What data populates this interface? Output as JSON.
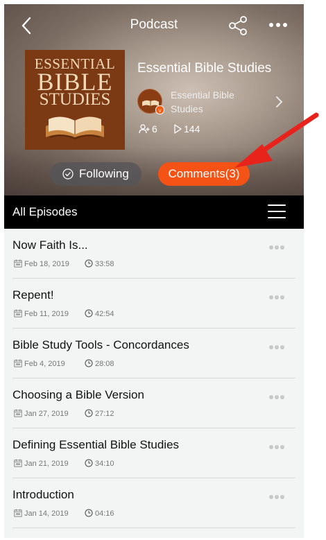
{
  "header": {
    "title": "Podcast",
    "back_icon": "chevron-left-icon",
    "share_icon": "share-icon",
    "more_icon": "ellipsis-icon"
  },
  "podcast": {
    "cover_lines": [
      "ESSENTIAL",
      "BIBLE",
      "STUDIES"
    ],
    "name": "Essential Bible Studies",
    "author": "Essential Bible Studies",
    "author_badge": "v",
    "subscribers": "6",
    "plays": "144"
  },
  "actions": {
    "following_label": "Following",
    "comments_label": "Comments(3)"
  },
  "episodes_bar": {
    "label": "All Episodes"
  },
  "episodes": [
    {
      "title": "Now Faith Is...",
      "date": "Feb 18, 2019",
      "duration": "33:58"
    },
    {
      "title": "Repent!",
      "date": "Feb 11, 2019",
      "duration": "42:54"
    },
    {
      "title": "Bible Study Tools - Concordances",
      "date": "Feb 4, 2019",
      "duration": "28:08"
    },
    {
      "title": "Choosing a Bible Version",
      "date": "Jan 27, 2019",
      "duration": "27:12"
    },
    {
      "title": "Defining Essential Bible Studies",
      "date": "Jan 21, 2019",
      "duration": "34:10"
    },
    {
      "title": "Introduction",
      "date": "Jan 14, 2019",
      "duration": "04:16"
    }
  ],
  "colors": {
    "accent": "#f55316",
    "annotation_arrow": "#e8231c",
    "cover_bg": "#7b3a14"
  }
}
